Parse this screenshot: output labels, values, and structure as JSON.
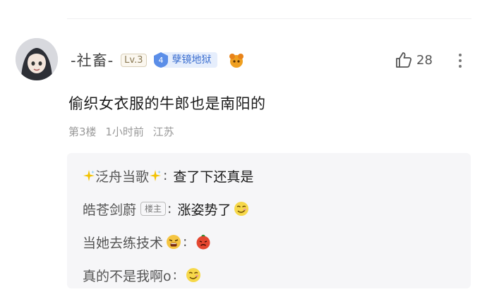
{
  "comment": {
    "username": "-社畜-",
    "level": "Lv.3",
    "rank_number": "4",
    "rank_title": "孽镜地狱",
    "text": "偷织女衣服的牛郎也是南阳的",
    "floor": "第3楼",
    "time": "1小时前",
    "location": "江苏",
    "likes": "28",
    "icons": {
      "like": "thumbs-up-icon",
      "more": "more-vertical-icon",
      "fan_badge": "orange-badge-icon"
    }
  },
  "replies": [
    {
      "user": "泛舟当歌",
      "user_decoration": "sparkle-icon",
      "is_op": false,
      "text": "查了下还真是",
      "trailing_emoji": ""
    },
    {
      "user": "皓苍剑蔚",
      "is_op": true,
      "op_label": "楼主",
      "text": "涨姿势了",
      "trailing_emoji": "huaji-face-emoji"
    },
    {
      "user": "当她去练技术",
      "user_emoji": "crying-face-emoji",
      "is_op": false,
      "text": "",
      "trailing_emoji": "angry-red-face-emoji"
    },
    {
      "user": "真的不是我啊o",
      "is_op": false,
      "text": "",
      "trailing_emoji": "huaji-face-emoji"
    }
  ],
  "colors": {
    "rank_blue": "#3c6fd0",
    "reply_bg": "#f6f6f8",
    "meta_gray": "#999999"
  }
}
